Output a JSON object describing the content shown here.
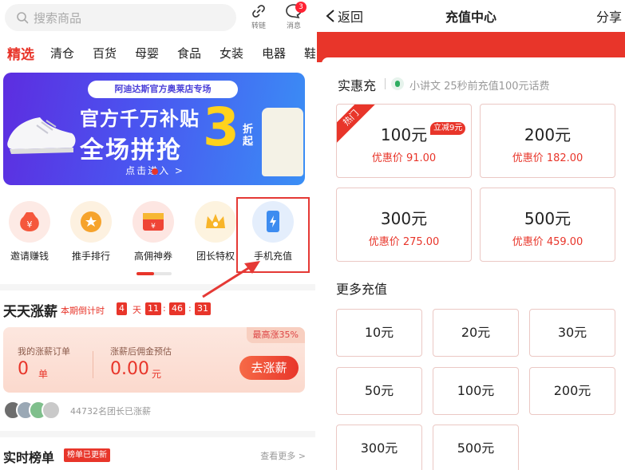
{
  "left": {
    "search": {
      "placeholder": "搜索商品"
    },
    "top_icons": [
      {
        "name": "link",
        "label": "转链"
      },
      {
        "name": "message",
        "label": "消息",
        "badge": "3"
      }
    ],
    "categories": [
      "精选",
      "清仓",
      "百货",
      "母婴",
      "食品",
      "女装",
      "电器",
      "鞋"
    ],
    "banner": {
      "tagline": "阿迪达斯官方奥莱店专场",
      "line1": "官方千万补贴",
      "line2": "全场拼抢",
      "big_number": "3",
      "unit": "折起",
      "cta": "点击进入 >"
    },
    "quick_entries": [
      {
        "label": "邀请赚钱",
        "icon": "money-bag-icon",
        "color": "#f5573c"
      },
      {
        "label": "推手排行",
        "icon": "medal-icon",
        "color": "#f6a32c"
      },
      {
        "label": "高佣神券",
        "icon": "coupon-icon",
        "color": "#ef4536"
      },
      {
        "label": "团长特权",
        "icon": "crown-icon",
        "color": "#f8b52a"
      },
      {
        "label": "手机充值",
        "icon": "phone-charge-icon",
        "color": "#3d8cf0"
      }
    ],
    "daily": {
      "title": "天天涨薪",
      "countdown_label": "本期倒计时",
      "days": "4",
      "days_unit": "天",
      "hours": "11",
      "minutes": "46",
      "seconds": "31",
      "max_tag": "最高涨35%",
      "orders_label": "我的涨薪订单",
      "orders_value": "0",
      "orders_unit": "单",
      "estimate_label": "涨薪后佣金预估",
      "estimate_value": "0.00",
      "estimate_unit": "元",
      "button": "去涨薪",
      "participants": "44732名团长已涨薪"
    },
    "ranking": {
      "title": "实时榜单",
      "tag": "榜单已更新",
      "more": "查看更多 >"
    }
  },
  "right": {
    "back": "返回",
    "title": "充值中心",
    "share": "分享",
    "section_title": "实惠充",
    "notice": "小讲文 25秒前充值100元话费",
    "hot_label": "热门",
    "plans": [
      {
        "amount": "100元",
        "price": "优惠价 91.00",
        "badge": "立减9元",
        "hot": true
      },
      {
        "amount": "200元",
        "price": "优惠价 182.00"
      },
      {
        "amount": "300元",
        "price": "优惠价 275.00"
      },
      {
        "amount": "500元",
        "price": "优惠价 459.00"
      }
    ],
    "more_title": "更多充值",
    "more": [
      "10元",
      "20元",
      "30元",
      "50元",
      "100元",
      "200元",
      "300元",
      "500元"
    ]
  },
  "colors": {
    "brand_red": "#e8352a",
    "highlight_box": "#e53935"
  }
}
